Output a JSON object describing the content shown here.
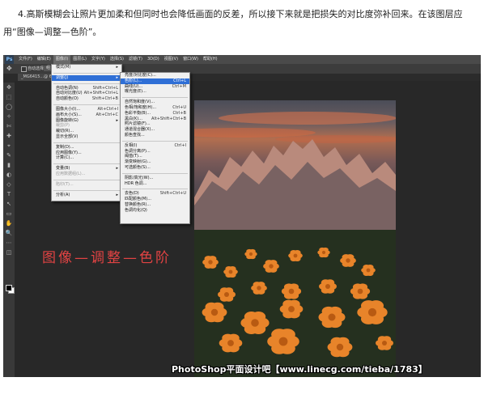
{
  "article": {
    "line1": "4.高斯模糊会让照片更加柔和但同时也会降低画面的反差，所以接下来就是把损失的对比度弥补回来。在该图层应",
    "line2": "用“图像—调整—色阶”。"
  },
  "ps": {
    "logo": "Ps",
    "menus": [
      "文件(F)",
      "编辑(E)",
      "图像(I)",
      "图层(L)",
      "文字(Y)",
      "选择(S)",
      "滤镜(T)",
      "3D(D)",
      "视图(V)",
      "窗口(W)",
      "帮助(H)"
    ],
    "options": {
      "move_icon": "✥",
      "autoselect": "自动选择",
      "group": "组"
    },
    "tab": "_MG6415...@ 66.7%",
    "tools": [
      "✥",
      "⬚",
      "◯",
      "✧",
      "✄",
      "✚",
      "⌖",
      "✎",
      "▮",
      "◐",
      "◇",
      "T",
      "↖",
      "▭",
      "✋",
      "🔍",
      "⋯",
      "◫"
    ],
    "image_menu": {
      "items": [
        {
          "label": "模式(M)",
          "shortcut": "",
          "arrow": true
        },
        {
          "sep": true
        },
        {
          "label": "调整(J)",
          "shortcut": "",
          "arrow": true,
          "highlight": true
        },
        {
          "sep": true
        },
        {
          "label": "自动色调(N)",
          "shortcut": "Shift+Ctrl+L"
        },
        {
          "label": "自动对比度(U)",
          "shortcut": "Alt+Shift+Ctrl+L"
        },
        {
          "label": "自动颜色(O)",
          "shortcut": "Shift+Ctrl+B"
        },
        {
          "sep": true
        },
        {
          "label": "图像大小(I)...",
          "shortcut": "Alt+Ctrl+I"
        },
        {
          "label": "画布大小(S)...",
          "shortcut": "Alt+Ctrl+C"
        },
        {
          "label": "图像旋转(G)",
          "shortcut": "",
          "arrow": true
        },
        {
          "label": "裁剪(P)",
          "shortcut": "",
          "dim": true
        },
        {
          "label": "裁切(R)...",
          "shortcut": ""
        },
        {
          "label": "显示全部(V)",
          "shortcut": ""
        },
        {
          "sep": true
        },
        {
          "label": "复制(D)...",
          "shortcut": ""
        },
        {
          "label": "应用图像(Y)...",
          "shortcut": ""
        },
        {
          "label": "计算(C)...",
          "shortcut": ""
        },
        {
          "sep": true
        },
        {
          "label": "变量(B)",
          "shortcut": "",
          "arrow": true
        },
        {
          "label": "应用数据组(L)...",
          "shortcut": "",
          "dim": true
        },
        {
          "sep": true
        },
        {
          "label": "陷印(T)...",
          "shortcut": "",
          "dim": true
        },
        {
          "sep": true
        },
        {
          "label": "分析(A)",
          "shortcut": "",
          "arrow": true
        }
      ]
    },
    "adjust_menu": {
      "items": [
        {
          "label": "亮度/对比度(C)...",
          "shortcut": ""
        },
        {
          "label": "色阶(L)...",
          "shortcut": "Ctrl+L",
          "highlight": true
        },
        {
          "label": "曲线(U)...",
          "shortcut": "Ctrl+M"
        },
        {
          "label": "曝光度(E)...",
          "shortcut": ""
        },
        {
          "sep": true
        },
        {
          "label": "自然饱和度(V)...",
          "shortcut": ""
        },
        {
          "label": "色相/饱和度(H)...",
          "shortcut": "Ctrl+U"
        },
        {
          "label": "色彩平衡(B)...",
          "shortcut": "Ctrl+B"
        },
        {
          "label": "黑白(K)...",
          "shortcut": "Alt+Shift+Ctrl+B"
        },
        {
          "label": "照片滤镜(F)...",
          "shortcut": ""
        },
        {
          "label": "通道混合器(X)...",
          "shortcut": ""
        },
        {
          "label": "颜色查找...",
          "shortcut": ""
        },
        {
          "sep": true
        },
        {
          "label": "反相(I)",
          "shortcut": "Ctrl+I"
        },
        {
          "label": "色调分离(P)...",
          "shortcut": ""
        },
        {
          "label": "阈值(T)...",
          "shortcut": ""
        },
        {
          "label": "渐变映射(G)...",
          "shortcut": ""
        },
        {
          "label": "可选颜色(S)...",
          "shortcut": ""
        },
        {
          "sep": true
        },
        {
          "label": "阴影/高光(W)...",
          "shortcut": ""
        },
        {
          "label": "HDR 色调...",
          "shortcut": ""
        },
        {
          "sep": true
        },
        {
          "label": "去色(D)",
          "shortcut": "Shift+Ctrl+U"
        },
        {
          "label": "匹配颜色(M)...",
          "shortcut": ""
        },
        {
          "label": "替换颜色(R)...",
          "shortcut": ""
        },
        {
          "label": "色调均化(Q)",
          "shortcut": ""
        }
      ]
    }
  },
  "overlay_caption": "图像—调整—色阶",
  "watermark": "PhotoShop平面设计吧【www.linecg.com/tieba/1783】",
  "colors": {
    "highlight": "#2f6fd6",
    "caption_red": "#e24343",
    "flower_orange": "#e8842a"
  }
}
